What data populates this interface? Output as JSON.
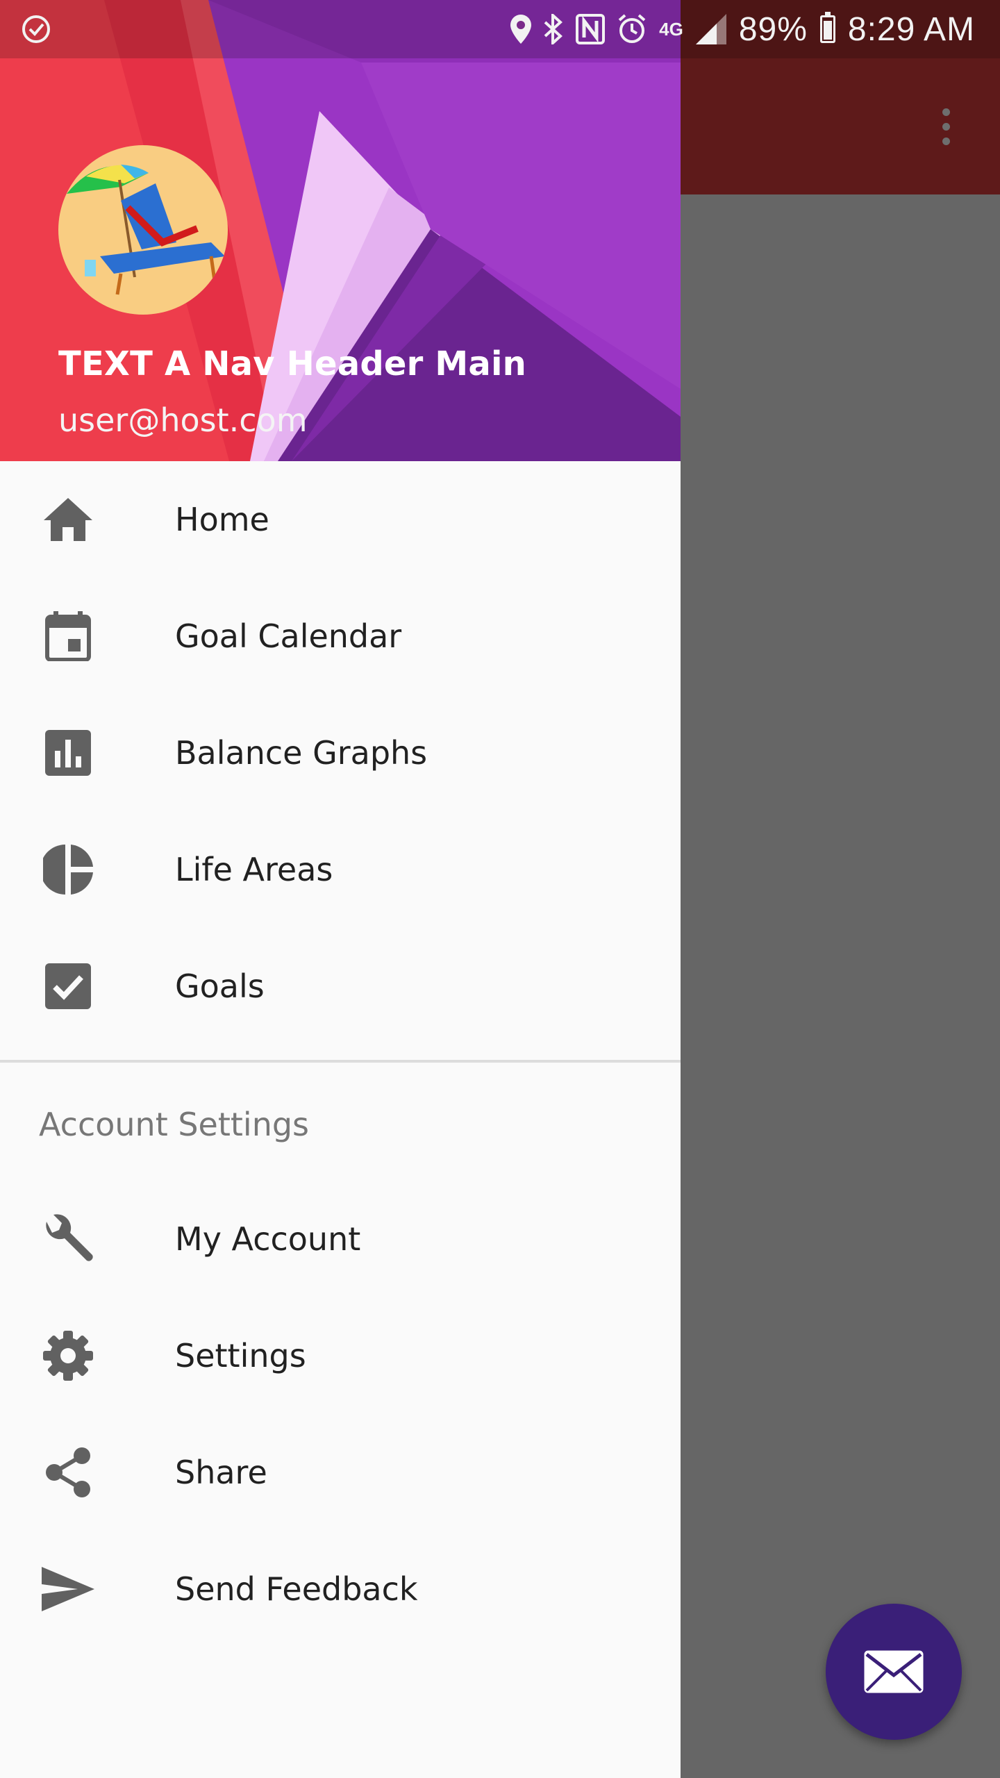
{
  "status_bar": {
    "battery_percent": "89%",
    "time": "8:29 AM",
    "network_tag": "4G",
    "icons": [
      "clock-check-icon",
      "location-icon",
      "bluetooth-icon",
      "nfc-icon",
      "alarm-icon",
      "signal-icon",
      "battery-icon"
    ]
  },
  "app": {
    "toolbar_color": "#5e1a1a",
    "fab_color": "#3a1f78",
    "fab_icon": "mail-icon",
    "overflow_icon": "more-vert-icon"
  },
  "drawer": {
    "header": {
      "name": "TEXT A Nav Header Main",
      "email": "user@host.com",
      "avatar_icon": "beach-chair-icon"
    },
    "primary_items": [
      {
        "label": "Home",
        "icon": "home-icon"
      },
      {
        "label": "Goal Calendar",
        "icon": "calendar-icon"
      },
      {
        "label": "Balance Graphs",
        "icon": "bar-chart-icon"
      },
      {
        "label": "Life Areas",
        "icon": "pie-chart-icon"
      },
      {
        "label": "Goals",
        "icon": "checkbox-icon"
      }
    ],
    "section_title": "Account Settings",
    "secondary_items": [
      {
        "label": "My Account",
        "icon": "wrench-icon"
      },
      {
        "label": "Settings",
        "icon": "gear-icon"
      },
      {
        "label": "Share",
        "icon": "share-icon"
      },
      {
        "label": "Send Feedback",
        "icon": "send-icon"
      }
    ],
    "icon_color": "#616161",
    "text_color": "#212121"
  }
}
